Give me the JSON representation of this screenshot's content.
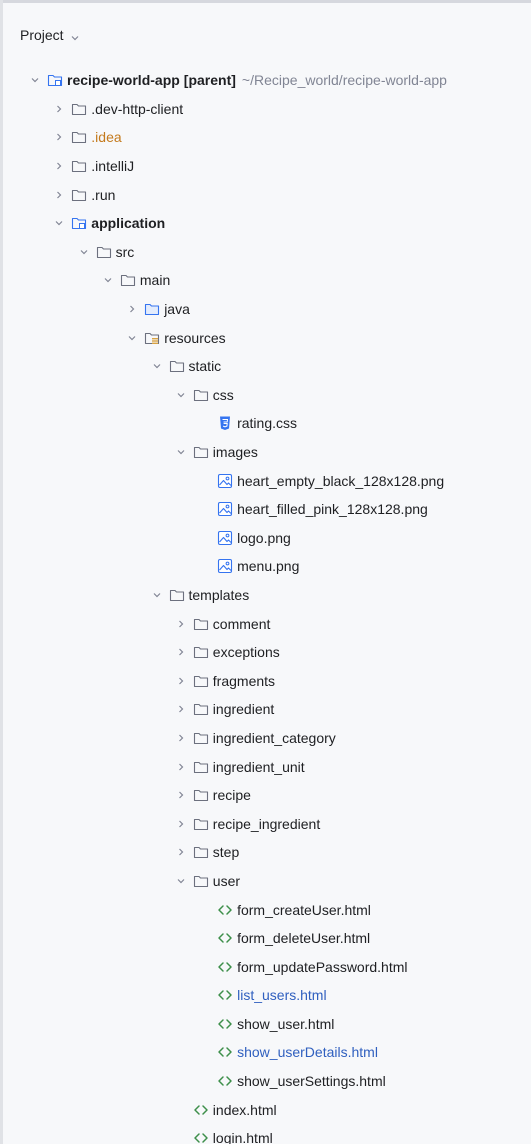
{
  "header": {
    "title": "Project"
  },
  "tree": [
    {
      "depth": 0,
      "state": "open",
      "icon": "module-folder-icon",
      "label": "recipe-world-app",
      "suffix": "[parent]",
      "path": "~/Recipe_world/recipe-world-app",
      "style": "bold-part"
    },
    {
      "depth": 1,
      "state": "closed",
      "icon": "folder-icon",
      "label": ".dev-http-client"
    },
    {
      "depth": 1,
      "state": "closed",
      "icon": "folder-icon",
      "label": ".idea",
      "style": "orange"
    },
    {
      "depth": 1,
      "state": "closed",
      "icon": "folder-icon",
      "label": ".intelliJ"
    },
    {
      "depth": 1,
      "state": "closed",
      "icon": "folder-icon",
      "label": ".run"
    },
    {
      "depth": 1,
      "state": "open",
      "icon": "module-folder-icon",
      "label": "application",
      "style": "bold"
    },
    {
      "depth": 2,
      "state": "open",
      "icon": "folder-icon",
      "label": "src"
    },
    {
      "depth": 3,
      "state": "open",
      "icon": "folder-icon",
      "label": "main"
    },
    {
      "depth": 4,
      "state": "closed",
      "icon": "source-folder-icon",
      "label": "java"
    },
    {
      "depth": 4,
      "state": "open",
      "icon": "resources-folder-icon",
      "label": "resources"
    },
    {
      "depth": 5,
      "state": "open",
      "icon": "folder-icon",
      "label": "static"
    },
    {
      "depth": 6,
      "state": "open",
      "icon": "folder-icon",
      "label": "css"
    },
    {
      "depth": 7,
      "state": "none",
      "icon": "css-file-icon",
      "label": "rating.css"
    },
    {
      "depth": 6,
      "state": "open",
      "icon": "folder-icon",
      "label": "images"
    },
    {
      "depth": 7,
      "state": "none",
      "icon": "image-file-icon",
      "label": "heart_empty_black_128x128.png"
    },
    {
      "depth": 7,
      "state": "none",
      "icon": "image-file-icon",
      "label": "heart_filled_pink_128x128.png"
    },
    {
      "depth": 7,
      "state": "none",
      "icon": "image-file-icon",
      "label": "logo.png"
    },
    {
      "depth": 7,
      "state": "none",
      "icon": "image-file-icon",
      "label": "menu.png"
    },
    {
      "depth": 5,
      "state": "open",
      "icon": "folder-icon",
      "label": "templates"
    },
    {
      "depth": 6,
      "state": "closed",
      "icon": "folder-icon",
      "label": "comment"
    },
    {
      "depth": 6,
      "state": "closed",
      "icon": "folder-icon",
      "label": "exceptions"
    },
    {
      "depth": 6,
      "state": "closed",
      "icon": "folder-icon",
      "label": "fragments"
    },
    {
      "depth": 6,
      "state": "closed",
      "icon": "folder-icon",
      "label": "ingredient"
    },
    {
      "depth": 6,
      "state": "closed",
      "icon": "folder-icon",
      "label": "ingredient_category"
    },
    {
      "depth": 6,
      "state": "closed",
      "icon": "folder-icon",
      "label": "ingredient_unit"
    },
    {
      "depth": 6,
      "state": "closed",
      "icon": "folder-icon",
      "label": "recipe"
    },
    {
      "depth": 6,
      "state": "closed",
      "icon": "folder-icon",
      "label": "recipe_ingredient"
    },
    {
      "depth": 6,
      "state": "closed",
      "icon": "folder-icon",
      "label": "step"
    },
    {
      "depth": 6,
      "state": "open",
      "icon": "folder-icon",
      "label": "user"
    },
    {
      "depth": 7,
      "state": "none",
      "icon": "html-file-icon",
      "label": "form_createUser.html"
    },
    {
      "depth": 7,
      "state": "none",
      "icon": "html-file-icon",
      "label": "form_deleteUser.html"
    },
    {
      "depth": 7,
      "state": "none",
      "icon": "html-file-icon",
      "label": "form_updatePassword.html"
    },
    {
      "depth": 7,
      "state": "none",
      "icon": "html-file-icon",
      "label": "list_users.html",
      "style": "blue"
    },
    {
      "depth": 7,
      "state": "none",
      "icon": "html-file-icon",
      "label": "show_user.html"
    },
    {
      "depth": 7,
      "state": "none",
      "icon": "html-file-icon",
      "label": "show_userDetails.html",
      "style": "blue"
    },
    {
      "depth": 7,
      "state": "none",
      "icon": "html-file-icon",
      "label": "show_userSettings.html"
    },
    {
      "depth": 6,
      "state": "none",
      "icon": "html-file-icon",
      "label": "index.html"
    },
    {
      "depth": 6,
      "state": "none",
      "icon": "html-file-icon",
      "label": "login.html"
    }
  ],
  "colors": {
    "background": "#f7f8fa",
    "text": "#1e1f22",
    "muted": "#818594",
    "folder": "#6c707e",
    "module_folder": "#3574f0",
    "resources_folder": "#d9a343",
    "css_icon": "#3574f0",
    "image_icon": "#3574f0",
    "html_icon": "#3d8f4a",
    "orange_text": "#c47a1d",
    "blue_text": "#2f5fbf"
  }
}
